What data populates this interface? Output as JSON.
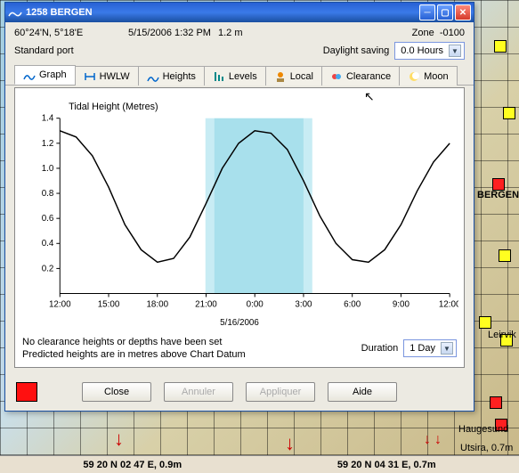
{
  "window": {
    "title": "1258  BERGEN",
    "coords": "60°24'N, 5°18'E",
    "datetime": "5/15/2006 1:32 PM",
    "height_now": "1.2 m",
    "zone_label": "Zone",
    "zone": "-0100",
    "port_type": "Standard port",
    "daylight_label": "Daylight saving",
    "daylight_value": "0.0 Hours"
  },
  "tabs": [
    {
      "label": "Graph"
    },
    {
      "label": "HWLW"
    },
    {
      "label": "Heights"
    },
    {
      "label": "Levels"
    },
    {
      "label": "Local"
    },
    {
      "label": "Clearance"
    },
    {
      "label": "Moon"
    }
  ],
  "chart_data": {
    "type": "line",
    "title": "Tidal Height (Metres)",
    "xlabel_date": "5/16/2006",
    "x_ticks": [
      "12:00",
      "15:00",
      "18:00",
      "21:00",
      "0:00",
      "3:00",
      "6:00",
      "9:00",
      "12:00"
    ],
    "y_ticks": [
      "0.2",
      "0.4",
      "0.6",
      "0.8",
      "1.0",
      "1.2",
      "1.4"
    ],
    "ylim": [
      0,
      1.4
    ],
    "highlight_band": {
      "start": "21:30",
      "end": "3:00"
    },
    "series": [
      {
        "name": "Tidal Height",
        "x_hours": [
          12,
          13,
          14,
          15,
          16,
          17,
          18,
          19,
          20,
          21,
          22,
          23,
          24,
          25,
          26,
          27,
          28,
          29,
          30,
          31,
          32,
          33,
          34,
          35,
          36
        ],
        "values": [
          1.3,
          1.25,
          1.1,
          0.85,
          0.55,
          0.35,
          0.25,
          0.28,
          0.45,
          0.72,
          1.0,
          1.2,
          1.3,
          1.28,
          1.15,
          0.9,
          0.62,
          0.4,
          0.27,
          0.25,
          0.35,
          0.55,
          0.82,
          1.05,
          1.2
        ]
      }
    ]
  },
  "notes": {
    "line1": "No clearance heights or depths have been set",
    "line2": "Predicted heights are in metres above Chart Datum"
  },
  "duration": {
    "label": "Duration",
    "value": "1 Day"
  },
  "buttons": {
    "close": "Close",
    "cancel": "Annuler",
    "apply": "Appliquer",
    "help": "Aide"
  },
  "status": {
    "left": "59 20 N 02 47 E, 0.9m",
    "right": "59 20 N 04 31 E, 0.7m"
  },
  "map_labels": {
    "bergen": "BERGEN",
    "leirvik": "Leirvik",
    "haugesund": "Haugesund",
    "utsira": "Utsira, 0.7m"
  }
}
